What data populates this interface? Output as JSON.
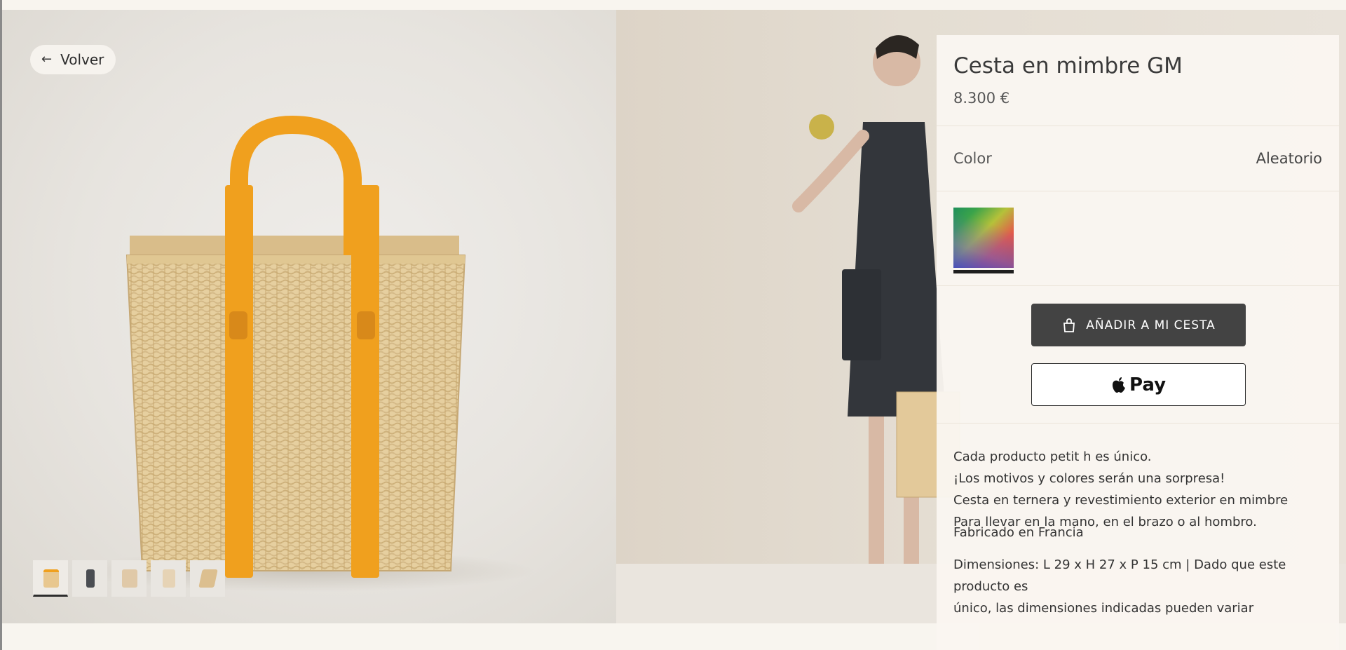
{
  "nav": {
    "back_label": "Volver",
    "back_icon": "arrow-left-icon"
  },
  "gallery": {
    "thumbnail_count": 5,
    "active_thumbnail": 1
  },
  "product": {
    "title": "Cesta en mimbre GM",
    "price": "8.300 €",
    "color_label": "Color",
    "color_value": "Aleatorio",
    "add_to_cart_label": "AÑADIR A MI CESTA",
    "apple_pay_label": "Pay",
    "description": {
      "line1": "Cada producto petit h es único.",
      "line2": "¡Los motivos y colores serán una sorpresa!",
      "line3": "Cesta en ternera y revestimiento exterior en mimbre",
      "line4": "Para llevar en la mano, en el brazo o al hombro.",
      "line5": "Fabricado en Francia",
      "line6": "Dimensiones: L 29 x H 27 x P 15 cm | Dado que este producto es",
      "line7": "único, las dimensiones indicadas pueden variar"
    }
  },
  "colors": {
    "panel_bg": "#faf6f0",
    "primary_button": "#434343",
    "strap_orange": "#f0a01e",
    "wicker": "#e3c99a"
  }
}
